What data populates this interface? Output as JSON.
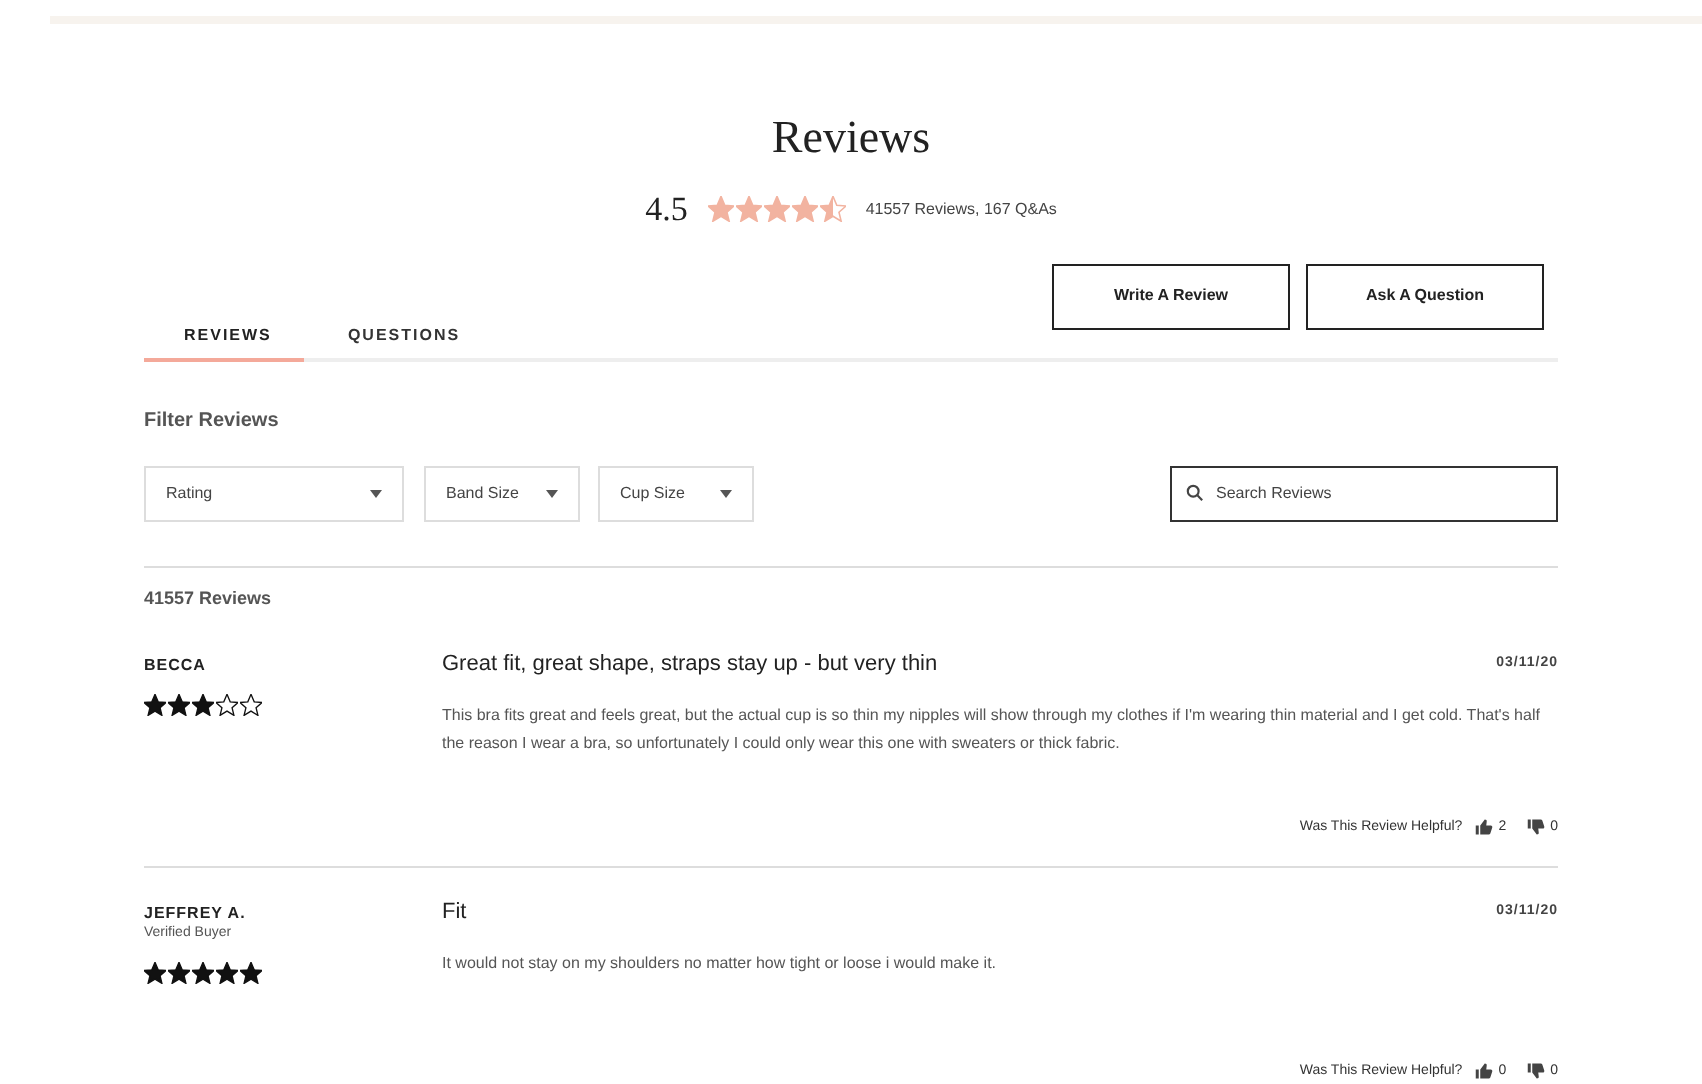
{
  "title": "Reviews",
  "summary": {
    "rating": "4.5",
    "stars": 4.5,
    "counts": "41557 Reviews, 167 Q&As"
  },
  "actions": [
    "Write A Review",
    "Ask A Question"
  ],
  "tabs": [
    {
      "label": "REVIEWS",
      "selected": true
    },
    {
      "label": "QUESTIONS",
      "selected": false
    }
  ],
  "filters": {
    "heading": "Filter Reviews",
    "dropdowns": [
      "Rating",
      "Band Size",
      "Cup Size"
    ],
    "search": {
      "placeholder": "Search Reviews"
    }
  },
  "review_count": "41557 Reviews",
  "reviews": [
    {
      "author": "BECCA",
      "stars": 3,
      "title": "Great fit, great shape, straps stay up - but very thin",
      "date": "03/11/20",
      "body": "This bra fits great and feels great, but the actual cup is so thin my nipples will show through my clothes if I'm wearing thin material and I get cold. That's half the reason I wear a bra, so unfortunately I could only wear this one with sweaters or thick fabric.",
      "helpful_label": "Was This Review Helpful?",
      "up": "2",
      "down": "0"
    },
    {
      "author": "JEFFREY A.",
      "badge": "Verified Buyer",
      "stars": 5,
      "title": "Fit",
      "date": "03/11/20",
      "body": "It would not stay on my shoulders no matter how tight or loose i would make it.",
      "helpful_label": "Was This Review Helpful?",
      "up": "0",
      "down": "0"
    }
  ]
}
